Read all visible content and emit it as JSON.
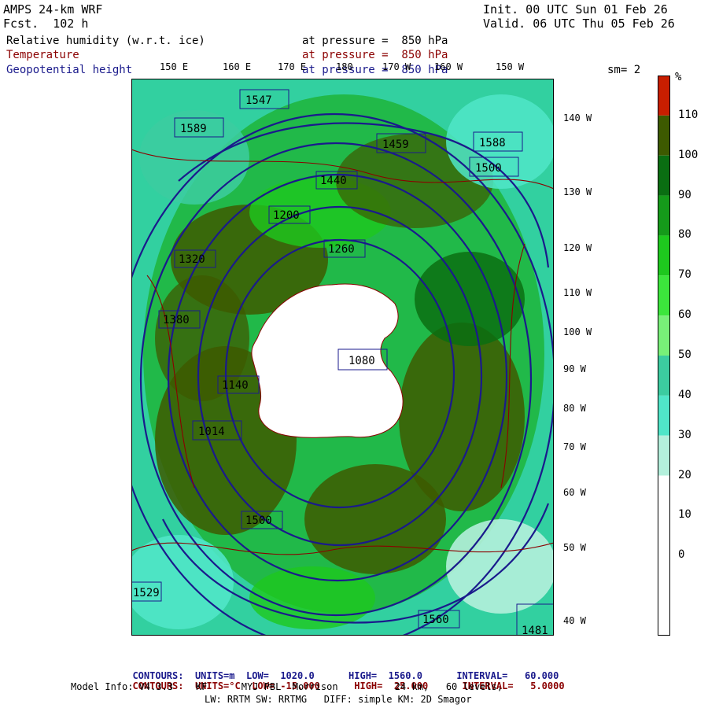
{
  "header": {
    "model": "AMPS 24-km WRF",
    "fcst": "Fcst.  102 h",
    "init": "Init. 00 UTC Sun 01 Feb 26",
    "valid": "Valid. 06 UTC Thu 05 Feb 26"
  },
  "fields": [
    {
      "name": "Relative humidity (w.r.t. ice)",
      "level": "at pressure =  850 hPa",
      "color": "#000000"
    },
    {
      "name": "Temperature",
      "level": "at pressure =  850 hPa",
      "color": "#8b0000"
    },
    {
      "name": "Geopotential height",
      "level": "at pressure =  850 hPa",
      "color": "#1a1a8c"
    }
  ],
  "smoothing": "sm= 2",
  "top_lon_labels": [
    "150 E",
    "160 E",
    "170 E",
    "180",
    "170 W",
    "160 W",
    "150 W"
  ],
  "right_lon_labels": [
    "140 W",
    "130 W",
    "120 W",
    "110 W",
    "100 W",
    "90 W",
    "80 W",
    "70 W",
    "60 W",
    "50 W",
    "40 W"
  ],
  "colorbar": {
    "unit": "%",
    "labels": [
      "110",
      "100",
      "90",
      "80",
      "70",
      "60",
      "50",
      "40",
      "30",
      "20",
      "10",
      "0"
    ],
    "colors": [
      "#c81e00",
      "#3d5a00",
      "#0a6e12",
      "#159a1a",
      "#1ec81e",
      "#3ce63c",
      "#78f078",
      "#3ccca0",
      "#50e6c8",
      "#b4f0dc",
      "#ffffff",
      "#ffffff",
      "#ffffff",
      "#ffffff"
    ]
  },
  "height_labels": [
    "1547",
    "1589",
    "1588",
    "1459",
    "1500",
    "1440",
    "1380",
    "1320",
    "1260",
    "1200",
    "1140",
    "1080",
    "1014",
    "1500",
    "1560",
    "1529",
    "1481"
  ],
  "footer": {
    "line1": {
      "label": "CONTOURS:",
      "units": "UNITS=m",
      "low": "LOW=  1020.0",
      "high": "HIGH=  1560.0",
      "interval": "INTERVAL=   60.000"
    },
    "line2": {
      "label": "CONTOURS:",
      "units": "UNITS=°C",
      "low": "LOW= -15.000",
      "high": "HIGH=  25.000",
      "interval": "INTERVAL=   5.0000"
    },
    "line3": "Model Info: V4.3.3    KF      MYJ PBL  Morrison          24 km,   60 levels,",
    "line4": "LW: RRTM SW: RRTMG   DIFF: simple KM: 2D Smagor"
  }
}
